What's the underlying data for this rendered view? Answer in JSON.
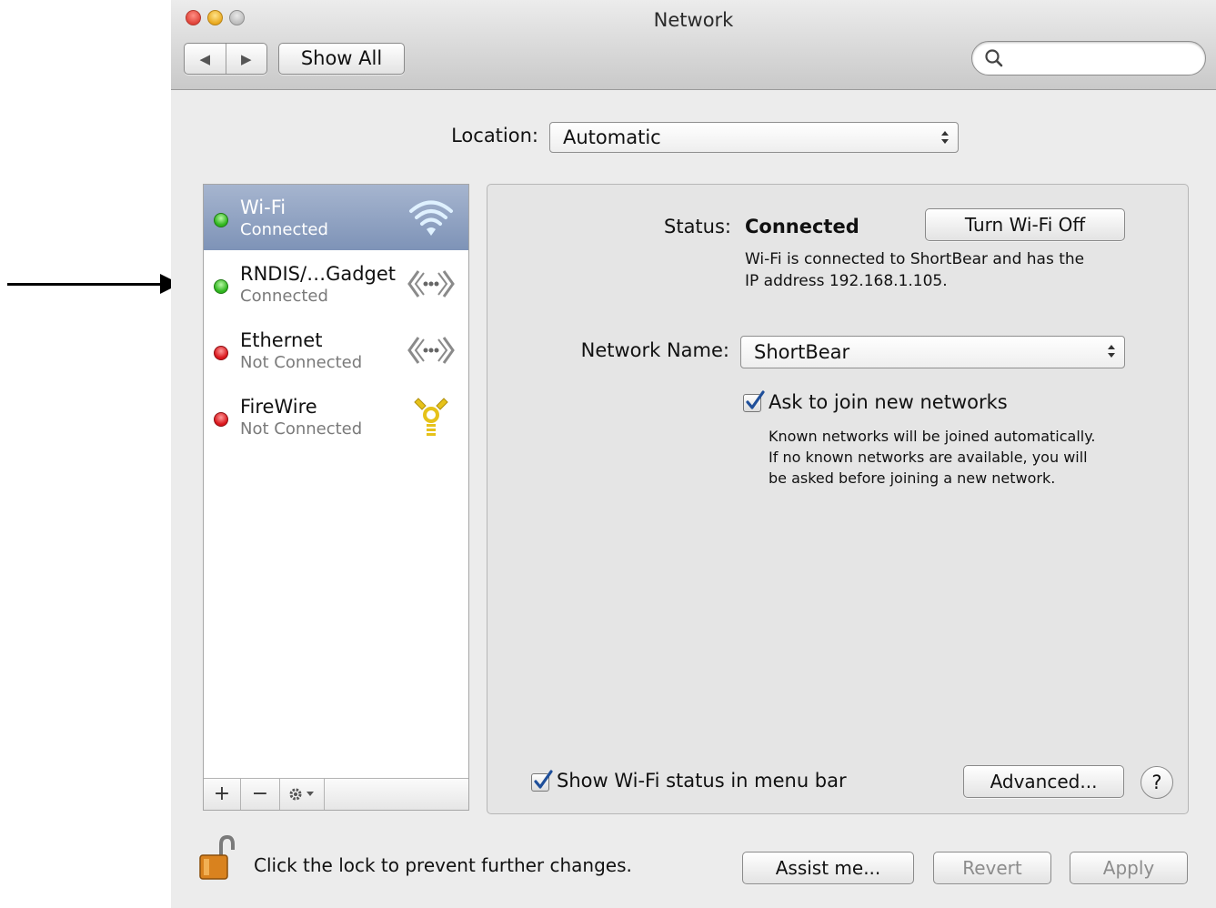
{
  "window": {
    "title": "Network"
  },
  "toolbar": {
    "back_icon": "back-arrow-icon",
    "forward_icon": "forward-arrow-icon",
    "show_all_label": "Show All",
    "search_placeholder": "",
    "search_value": ""
  },
  "location": {
    "label": "Location:",
    "value": "Automatic"
  },
  "services": [
    {
      "name": "Wi-Fi",
      "status": "Connected",
      "status_color": "green",
      "icon": "wifi-icon",
      "selected": true
    },
    {
      "name": "RNDIS/…Gadget",
      "status": "Connected",
      "status_color": "green",
      "icon": "ethernet-icon",
      "selected": false
    },
    {
      "name": "Ethernet",
      "status": "Not Connected",
      "status_color": "red",
      "icon": "ethernet-icon",
      "selected": false
    },
    {
      "name": "FireWire",
      "status": "Not Connected",
      "status_color": "red",
      "icon": "firewire-icon",
      "selected": false
    }
  ],
  "sidebar_controls": {
    "add_label": "+",
    "remove_label": "−"
  },
  "detail": {
    "status_label": "Status:",
    "status_value": "Connected",
    "turn_off_label": "Turn Wi-Fi Off",
    "status_desc_line1": "Wi-Fi is connected to ShortBear and has the",
    "status_desc_line2": "IP address 192.168.1.105.",
    "network_name_label": "Network Name:",
    "network_name_value": "ShortBear",
    "ask_join_label": "Ask to join new networks",
    "ask_join_checked": true,
    "ask_join_desc_line1": "Known networks will be joined automatically.",
    "ask_join_desc_line2": "If no known networks are available, you will",
    "ask_join_desc_line3": "be asked before joining a new network.",
    "show_status_label": "Show Wi-Fi status in menu bar",
    "show_status_checked": true,
    "advanced_label": "Advanced...",
    "help_label": "?"
  },
  "footer": {
    "lock_text": "Click the lock to prevent further changes.",
    "assist_label": "Assist me...",
    "revert_label": "Revert",
    "apply_label": "Apply"
  },
  "colors": {
    "selection": "#8a9dbd",
    "status_green": "#2fb51e",
    "status_red": "#d9161c",
    "checkbox_accent": "#1f4f9a"
  }
}
